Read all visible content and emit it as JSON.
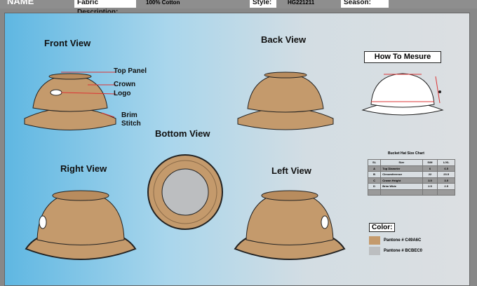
{
  "header": {
    "name": "NAME",
    "fabric_label": "Fabric Description:",
    "fabric_value": "100% Cotton",
    "style_label": "Style:",
    "style_value": "HG221211",
    "season_label": "Season:"
  },
  "views": {
    "front": "Front View",
    "back": "Back View",
    "bottom": "Bottom View",
    "right": "Right View",
    "left": "Left View"
  },
  "annotations": {
    "top_panel": "Top Panel",
    "crown": "Crown",
    "logo": "Logo",
    "brim": "Brim",
    "stitch": "Stitch"
  },
  "measure": {
    "title": "How To Mesure"
  },
  "size_chart": {
    "title": "Bucket Hat Size Chart",
    "headers": [
      "SL",
      "Size",
      "S/M",
      "L/XL"
    ],
    "rows": [
      [
        "A",
        "Top Diameter",
        "6",
        "6.5"
      ],
      [
        "B",
        "Circumference",
        "22",
        "23.5"
      ],
      [
        "C",
        "Crown Height",
        "3.5",
        "3.5"
      ],
      [
        "D",
        "Brim Wide",
        "2.5",
        "2.5"
      ]
    ]
  },
  "color": {
    "title": "Color:",
    "swatches": [
      {
        "label": "Pantone # C49A6C",
        "hex": "#c49a6c"
      },
      {
        "label": "Pantone # BCBEC0",
        "hex": "#bcbec0"
      }
    ]
  }
}
